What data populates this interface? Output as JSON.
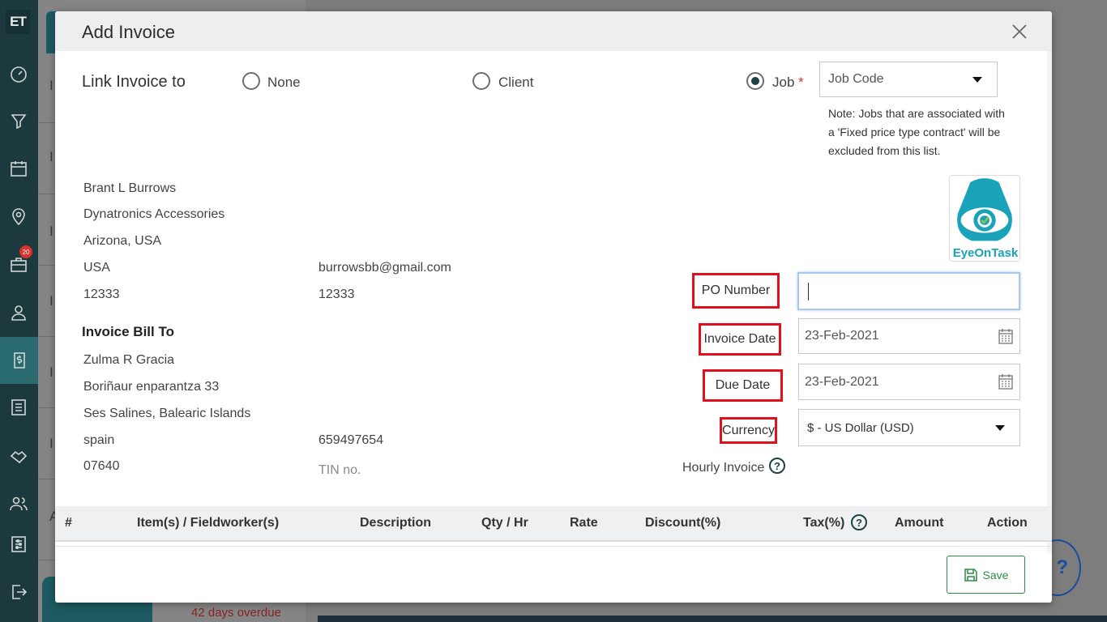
{
  "app": {
    "logo_text": "ET",
    "notification_count": "20",
    "background_status": "42 days overdue",
    "sidebar_icons": [
      "dashboard-icon",
      "funnel-icon",
      "calendar-icon",
      "map-pin-icon",
      "briefcase-icon",
      "user-icon",
      "dollar-icon",
      "list-icon",
      "handshake-icon",
      "team-icon",
      "settings-sliders-icon",
      "logout-icon"
    ]
  },
  "modal": {
    "title": "Add Invoice",
    "link_invoice_label": "Link Invoice to",
    "radio_none": "None",
    "radio_client": "Client",
    "radio_job": "Job",
    "required_mark": "*",
    "selected_link": "Job",
    "job_code_placeholder": "Job Code",
    "job_note": "Note: Jobs that are associated with a 'Fixed price type contract' will be excluded from this list.",
    "company_logo_text": "EyeOnTask",
    "client": {
      "name": "Brant L Burrows",
      "company": "Dynatronics Accessories",
      "region": "Arizona, USA",
      "country": "USA",
      "zip": "12333",
      "email": "burrowsbb@gmail.com",
      "phone": "12333"
    },
    "bill_to": {
      "heading": "Invoice Bill To",
      "name": "Zulma R Gracia",
      "street": "Boriñaur enparantza 33",
      "city": "Ses Salines, Balearic Islands",
      "country": "spain",
      "zip": "07640",
      "phone": "659497654",
      "tin_placeholder": "TIN no."
    },
    "fields": {
      "po_number_label": "PO Number",
      "po_number_value": "",
      "invoice_date_label": "Invoice Date",
      "invoice_date_value": "23-Feb-2021",
      "due_date_label": "Due Date",
      "due_date_value": "23-Feb-2021",
      "currency_label": "Currency",
      "currency_value": "$ - US Dollar (USD)",
      "hourly_invoice_label": "Hourly Invoice"
    },
    "table_headers": [
      "#",
      "Item(s) / Fieldworker(s)",
      "Description",
      "Qty / Hr",
      "Rate",
      "Discount(%)",
      "Tax(%)",
      "Amount",
      "Action"
    ],
    "save_label": "Save"
  },
  "colors": {
    "brand_dark": "#1c3a3e",
    "brand_teal": "#1d5a60",
    "highlight_red": "#e0101c",
    "save_green": "#2e8b4a"
  }
}
